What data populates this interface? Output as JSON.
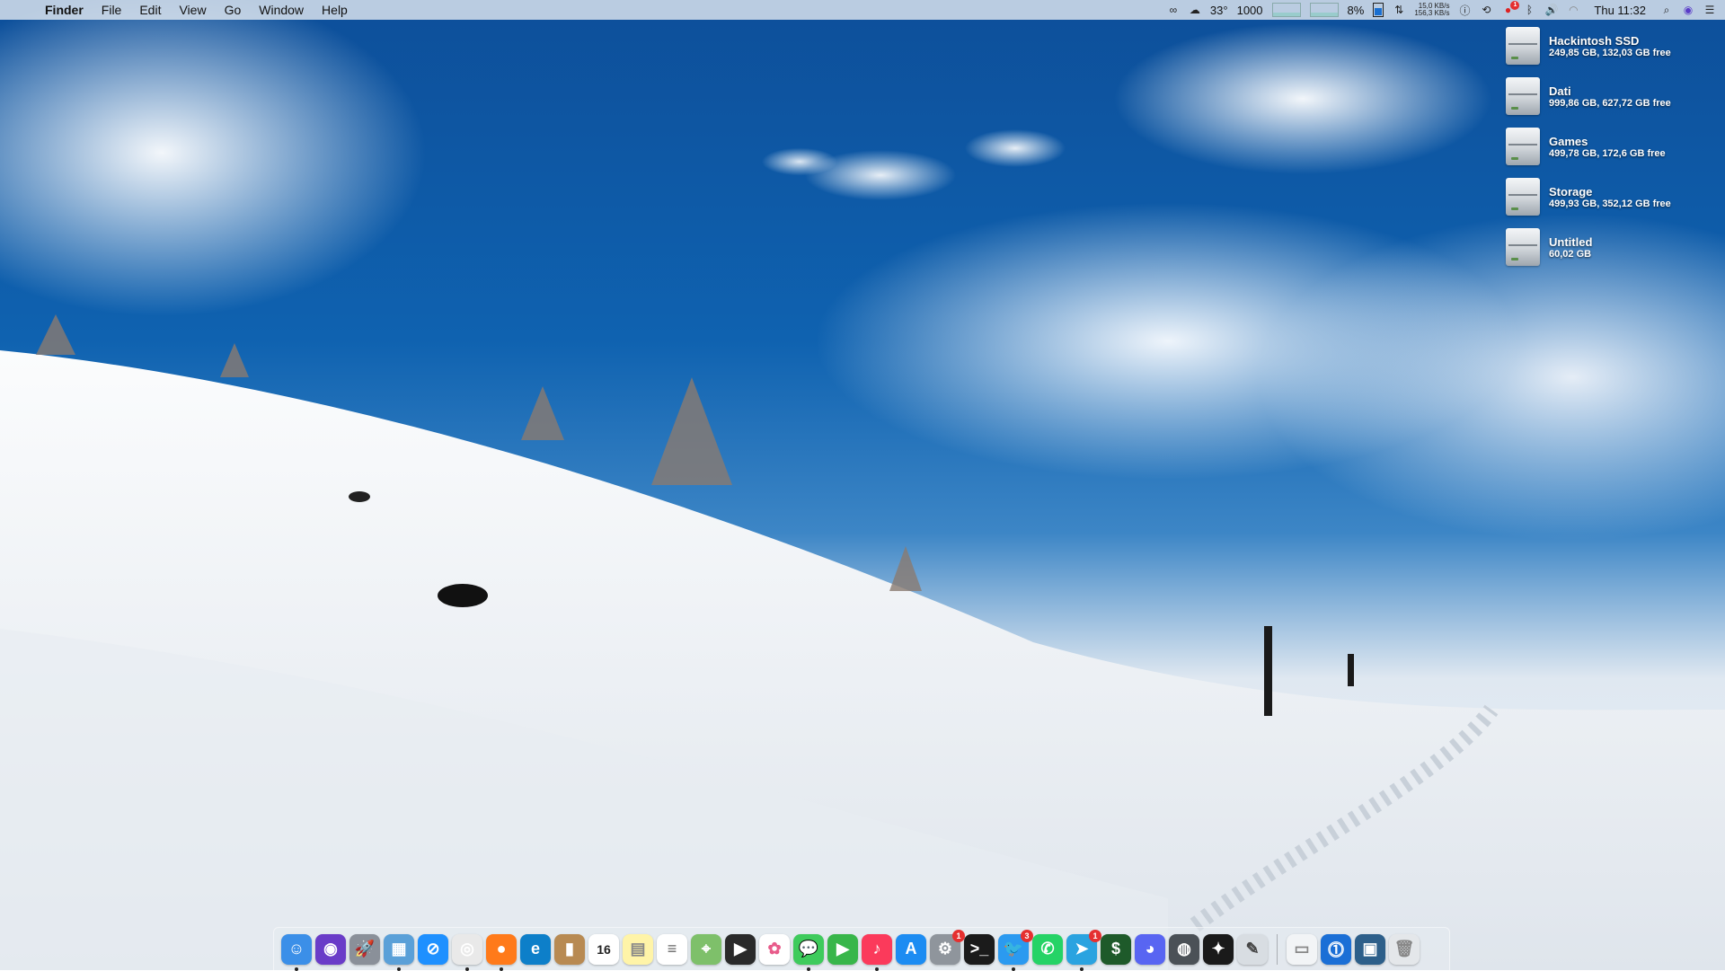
{
  "menubar": {
    "apple_icon": "apple-logo-icon",
    "app_name": "Finder",
    "menus": [
      "File",
      "Edit",
      "View",
      "Go",
      "Window",
      "Help"
    ],
    "status": {
      "temperature": "33°",
      "fan": "1000",
      "cpu_percent": "8%",
      "net_up": "15,0 KB/s",
      "net_down": "156,3 KB/s",
      "notification_badge": "1",
      "clock": "Thu 11:32"
    }
  },
  "drives": [
    {
      "name": "Hackintosh SSD",
      "info": "249,85 GB, 132,03 GB free"
    },
    {
      "name": "Dati",
      "info": "999,86 GB, 627,72 GB free"
    },
    {
      "name": "Games",
      "info": "499,78 GB, 172,6 GB free"
    },
    {
      "name": "Storage",
      "info": "499,93 GB, 352,12 GB free"
    },
    {
      "name": "Untitled",
      "info": "60,02 GB"
    }
  ],
  "dock": {
    "apps": [
      {
        "icon": "finder-icon",
        "color": "#3b8fe8",
        "glyph": "☺",
        "running": true
      },
      {
        "icon": "siri-icon",
        "color": "#6a3cc8",
        "glyph": "◉"
      },
      {
        "icon": "launchpad-icon",
        "color": "#8a9099",
        "glyph": "🚀"
      },
      {
        "icon": "preview-icon",
        "color": "#5aa0d8",
        "glyph": "▦",
        "running": true
      },
      {
        "icon": "safari-icon",
        "color": "#1e90ff",
        "glyph": "⊘"
      },
      {
        "icon": "chrome-icon",
        "color": "#e9e9e9",
        "glyph": "◎",
        "running": true
      },
      {
        "icon": "firefox-icon",
        "color": "#ff7a1a",
        "glyph": "●",
        "running": true
      },
      {
        "icon": "edge-icon",
        "color": "#0d7fc9",
        "glyph": "e"
      },
      {
        "icon": "contacts-icon",
        "color": "#b88a52",
        "glyph": "▮"
      },
      {
        "icon": "calendar-icon",
        "color": "#ffffff",
        "glyph": "16",
        "text_color": "#222"
      },
      {
        "icon": "notes-icon",
        "color": "#fff4a8",
        "glyph": "▤",
        "text_color": "#888"
      },
      {
        "icon": "reminders-icon",
        "color": "#ffffff",
        "glyph": "≡",
        "text_color": "#666"
      },
      {
        "icon": "maps-icon",
        "color": "#7ec06a",
        "glyph": "⌖"
      },
      {
        "icon": "final-cut-icon",
        "color": "#2a2a2a",
        "glyph": "▶"
      },
      {
        "icon": "photos-icon",
        "color": "#ffffff",
        "glyph": "✿",
        "text_color": "#e85b8a"
      },
      {
        "icon": "messages-icon",
        "color": "#3ecb5c",
        "glyph": "💬",
        "running": true
      },
      {
        "icon": "facetime-icon",
        "color": "#38b64a",
        "glyph": "▶"
      },
      {
        "icon": "music-icon",
        "color": "#fb3a5b",
        "glyph": "♪",
        "running": true
      },
      {
        "icon": "app-store-icon",
        "color": "#1c8cf2",
        "glyph": "A"
      },
      {
        "icon": "system-preferences-icon",
        "color": "#8f959c",
        "glyph": "⚙",
        "badge": "1"
      },
      {
        "icon": "terminal-icon",
        "color": "#1b1b1b",
        "glyph": ">_"
      },
      {
        "icon": "tweetbot-icon",
        "color": "#2b9af0",
        "glyph": "🐦",
        "badge": "3",
        "running": true
      },
      {
        "icon": "whatsapp-icon",
        "color": "#25d366",
        "glyph": "✆"
      },
      {
        "icon": "telegram-icon",
        "color": "#2aa3e0",
        "glyph": "➤",
        "badge": "1",
        "running": true
      },
      {
        "icon": "money-icon",
        "color": "#1e5a2a",
        "glyph": "$"
      },
      {
        "icon": "discord-icon",
        "color": "#5865f2",
        "glyph": "◕"
      },
      {
        "icon": "disk-utility-icon",
        "color": "#4b5157",
        "glyph": "◍"
      },
      {
        "icon": "dropbox-icon",
        "color": "#1a1a1a",
        "glyph": "✦"
      },
      {
        "icon": "script-editor-icon",
        "color": "#d8dde2",
        "glyph": "✎",
        "text_color": "#444"
      }
    ],
    "others": [
      {
        "icon": "downloads-stack-icon",
        "color": "#f2f4f6",
        "glyph": "▭",
        "text_color": "#888"
      },
      {
        "icon": "onepassword-icon",
        "color": "#1b6fd6",
        "glyph": "⓵"
      },
      {
        "icon": "screenshot-stack-icon",
        "color": "#2d5f8a",
        "glyph": "▣"
      },
      {
        "icon": "trash-icon",
        "color": "#e4e7ea",
        "glyph": "🗑",
        "text_color": "#888"
      }
    ]
  }
}
